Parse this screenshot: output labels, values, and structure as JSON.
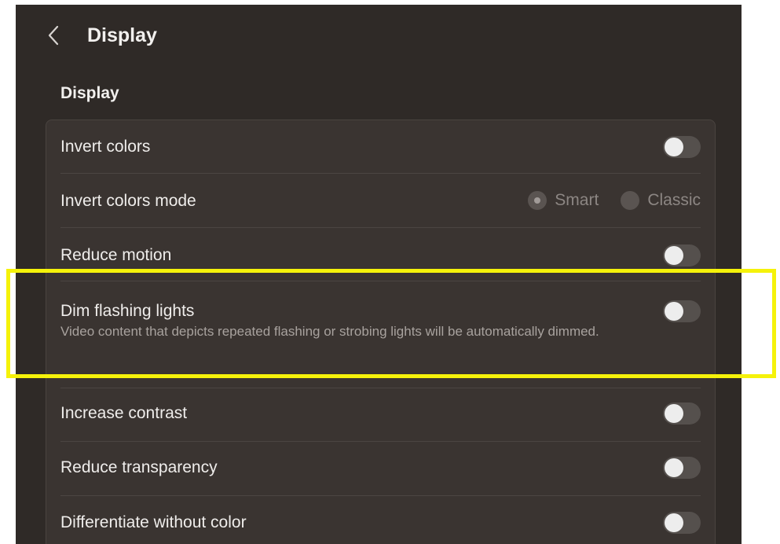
{
  "header": {
    "title": "Display",
    "back_icon": "chevron-left-icon"
  },
  "section": {
    "title": "Display"
  },
  "rows": [
    {
      "label": "Invert colors",
      "control": "toggle",
      "on": false
    },
    {
      "label": "Invert colors mode",
      "control": "radio",
      "options": [
        {
          "label": "Smart",
          "selected": true
        },
        {
          "label": "Classic",
          "selected": false
        }
      ]
    },
    {
      "label": "Reduce motion",
      "control": "toggle",
      "on": false
    },
    {
      "label": "Dim flashing lights",
      "description": "Video content that depicts repeated flashing or strobing lights will be automatically dimmed.",
      "control": "toggle",
      "on": false
    },
    {
      "label": "Increase contrast",
      "control": "toggle",
      "on": false
    },
    {
      "label": "Reduce transparency",
      "control": "toggle",
      "on": false
    },
    {
      "label": "Differentiate without color",
      "control": "toggle",
      "on": false
    }
  ],
  "colors": {
    "background": "#2f2a27",
    "group": "#3a3431",
    "highlight": "#f5f20a"
  }
}
